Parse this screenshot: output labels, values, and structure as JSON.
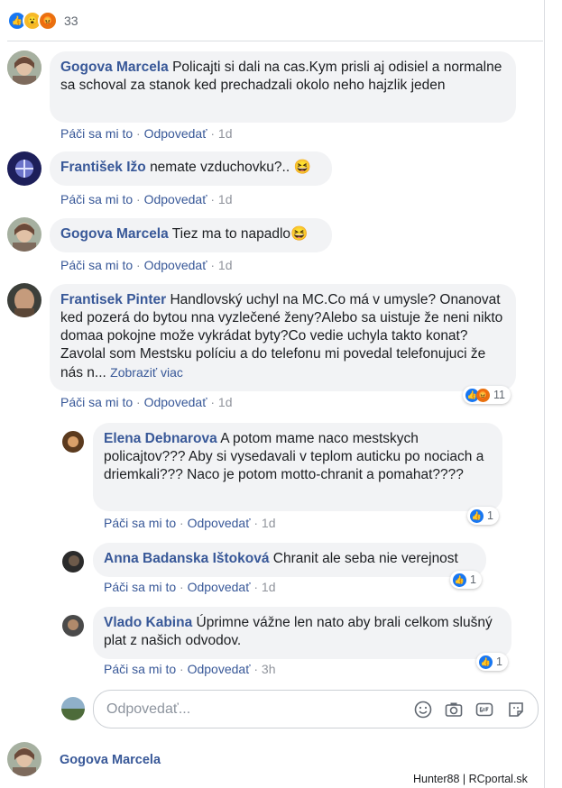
{
  "reaction_summary": {
    "count": "33",
    "icons": [
      "like-icon",
      "wow-icon",
      "angry-icon"
    ]
  },
  "comments": [
    {
      "author": "Gogova Marcela",
      "text": "Policajti si dali na cas.Kym prisli aj odisiel a normalne sa schoval za stanok ked prechadzali okolo neho hajzlik jeden",
      "like": "Páči sa mi to",
      "reply": "Odpovedať",
      "time": "1d"
    },
    {
      "author": "František Ižo",
      "text": "nemate vzduchovku?..",
      "emoji": "😆",
      "like": "Páči sa mi to",
      "reply": "Odpovedať",
      "time": "1d"
    },
    {
      "author": "Gogova Marcela",
      "text": "Tiez ma to napadlo",
      "emoji": "😆",
      "like": "Páči sa mi to",
      "reply": "Odpovedať",
      "time": "1d"
    },
    {
      "author": "Frantisek Pinter",
      "text": "Handlovský uchyl na MC.Co má v umysle? Onanovat ked pozerá do bytou nna vyzlečené ženy?Alebo sa uistuje že neni nikto domaa pokojne može vykrádat byty?Co vedie uchyla takto konat?Zavolal som Mestsku políciu a do telefonu mi povedal telefonujuci že nás n...",
      "more": "Zobraziť viac",
      "like": "Páči sa mi to",
      "reply": "Odpovedať",
      "time": "1d",
      "reactions": "11"
    }
  ],
  "replies": [
    {
      "author": "Elena Debnarova",
      "text": "A potom mame naco mestskych policajtov??? Aby si vysedavali v teplom auticku po nociach a driemkali??? Naco je potom motto-chranit a pomahat????",
      "like": "Páči sa mi to",
      "reply": "Odpovedať",
      "time": "1d",
      "reactions": "1"
    },
    {
      "author": "Anna Badanska Ištoková",
      "text": "Chranit ale seba nie verejnost",
      "like": "Páči sa mi to",
      "reply": "Odpovedať",
      "time": "1d",
      "reactions": "1"
    },
    {
      "author": "Vlado Kabina",
      "text": "Úprimne vážne len nato aby brali celkom slušný plat z našich odvodov.",
      "like": "Páči sa mi to",
      "reply": "Odpovedať",
      "time": "3h",
      "reactions": "1"
    }
  ],
  "reply_box": {
    "placeholder": "Odpovedať..."
  },
  "next_comment": {
    "author": "Gogova Marcela"
  },
  "watermark": "Hunter88 | RCportal.sk",
  "colors": {
    "link": "#385898",
    "bubble": "#f2f3f5",
    "like": "#1877f2",
    "angry": "#e9710f"
  }
}
